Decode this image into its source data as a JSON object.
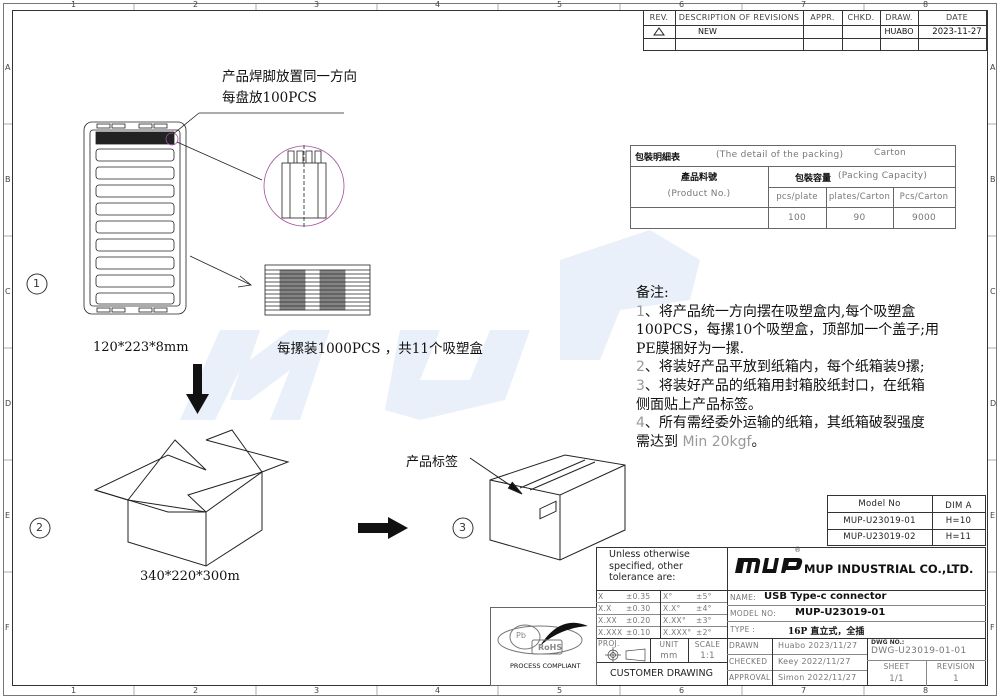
{
  "frame": {
    "columns": [
      "1",
      "2",
      "3",
      "4",
      "5",
      "6",
      "7",
      "8"
    ],
    "rows": [
      "A",
      "B",
      "C",
      "D",
      "E",
      "F"
    ]
  },
  "revision_table": {
    "headers": [
      "REV.",
      "DESCRIPTION OF REVISIONS",
      "APPR.",
      "CHKD.",
      "DRAW.",
      "DATE"
    ],
    "rows": [
      {
        "rev_icon": "triangle-icon",
        "description": "NEW",
        "appr": "",
        "chkd": "",
        "draw": "HUABO",
        "date": "2023-11-27"
      }
    ]
  },
  "step1": {
    "marker": "1",
    "note_line1": "产品焊脚放置同一方向",
    "note_line2": "每盘放100PCS",
    "tray_size": "120*223*8mm",
    "stack_note": "每摞装1000PCS ，共11个吸塑盒"
  },
  "step2": {
    "marker": "2",
    "carton_size": "340*220*300m"
  },
  "step3": {
    "marker": "3",
    "label_note": "产品标签"
  },
  "packing_table": {
    "title_cn": "包裝明細表",
    "title_en": "(The detail of the packing)",
    "unit": "Carton",
    "product_cn": "產品料號",
    "product_en": "(Product No.)",
    "capacity_cn": "包裝容量",
    "capacity_en": "(Packing Capacity)",
    "columns": [
      "pcs/plate",
      "plates/Carton",
      "Pcs/Carton"
    ],
    "row": {
      "product": "",
      "values": [
        "100",
        "90",
        "9000"
      ]
    }
  },
  "notes": {
    "title": "备注:",
    "items": [
      {
        "num": "1",
        "lines": [
          "、将产品统一方向摆在吸塑盒内,每个吸塑盒",
          "100PCS，每摞10个吸塑盒，顶部加一个盖子;用",
          "PE膜捆好为一摞."
        ]
      },
      {
        "num": "2",
        "lines": [
          "、将装好产品平放到纸箱内，每个纸箱装9摞;"
        ]
      },
      {
        "num": "3",
        "lines": [
          "、将装好产品的纸箱用封箱胶纸封口，在纸箱",
          "侧面贴上产品标签。"
        ]
      },
      {
        "num": "4",
        "lines": [
          "、所有需经委外运输的纸箱，其纸箱破裂强度",
          "需达到 "
        ],
        "suffix": "Min 20kgf",
        "end": "。"
      }
    ]
  },
  "model_table": {
    "headers": [
      "Model No",
      "DIM A"
    ],
    "rows": [
      [
        "MUP-U23019-01",
        "H=10"
      ],
      [
        "MUP-U23019-02",
        "H=11"
      ]
    ]
  },
  "rohs": {
    "text": "RoHS",
    "pb": "Pb",
    "caption": "PROCESS COMPLIANT"
  },
  "title_block": {
    "tolerance_note": [
      "Unless otherwise",
      "specified, other",
      "tolerance are:"
    ],
    "tolerances": [
      [
        "X",
        "±0.35",
        "X°",
        "±5°"
      ],
      [
        "X.X",
        "±0.30",
        "X.X°",
        "±4°"
      ],
      [
        "X.XX",
        "±0.20",
        "X.XX°",
        "±3°"
      ],
      [
        "X.XXX",
        "±0.10",
        "X.XXX°",
        "±2°"
      ]
    ],
    "proj_label": "PROJ.",
    "unit_label": "UNIT",
    "unit": "mm",
    "scale_label": "SCALE",
    "scale": "1:1",
    "customer_drawing": "CUSTOMER  DRAWING",
    "logo": "MUP",
    "registered": "®",
    "company": "MUP INDUSTRIAL CO.,LTD.",
    "name_label": "NAME:",
    "name": "USB Type-c connector",
    "model_label": "MODEL NO:",
    "model": "MUP-U23019-01",
    "type_label": "TYPE :",
    "type": "16P 直立式，全插",
    "drawn_label": "DRAWN",
    "drawn": "Huabo 2023/11/27",
    "checked_label": "CHECKED",
    "checked": "Keey  2022/11/27",
    "approval_label": "APPROVAL",
    "approval": "Simon 2022/11/27",
    "dwg_no_label": "DWG NO.:",
    "dwg_no": "DWG-U23019-01-01",
    "sheet_label": "SHEET",
    "sheet": "1/1",
    "revision_label": "REVISION",
    "revision": "1"
  },
  "colors": {
    "line": "#333333",
    "watermark": "#e6eef8",
    "detail_circle": "#a050a0"
  }
}
